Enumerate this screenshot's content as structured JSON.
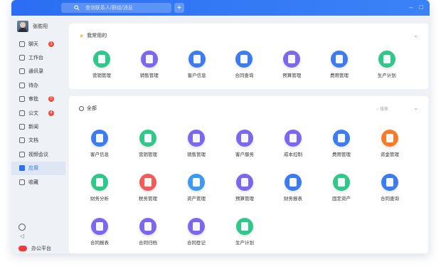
{
  "titlebar": {
    "search_placeholder": "查询联系人/群组/消息",
    "add": "+",
    "minimize": "–",
    "maximize": "□"
  },
  "user": {
    "name": "张胜阳"
  },
  "nav": [
    {
      "key": "chat",
      "label": "聊天",
      "badge": "1"
    },
    {
      "key": "workbench",
      "label": "工作台",
      "badge": ""
    },
    {
      "key": "contacts",
      "label": "通讯录",
      "badge": ""
    },
    {
      "key": "todo",
      "label": "待办",
      "badge": ""
    },
    {
      "key": "approval",
      "label": "审批",
      "badge": "5"
    },
    {
      "key": "document",
      "label": "公文",
      "badge": "4"
    },
    {
      "key": "news",
      "label": "新闻",
      "badge": ""
    },
    {
      "key": "archive",
      "label": "文档",
      "badge": ""
    },
    {
      "key": "video",
      "label": "视频会议",
      "badge": ""
    },
    {
      "key": "apps",
      "label": "应用",
      "badge": "",
      "active": true
    },
    {
      "key": "favorites",
      "label": "收藏",
      "badge": ""
    }
  ],
  "sidebar_footer": {
    "collapse": "◁",
    "office": "办公平台"
  },
  "frequent": {
    "title": "我常用的",
    "apps": [
      {
        "label": "营销管理",
        "icon": "marketing-icon",
        "color": "#2fc78c"
      },
      {
        "label": "销售管理",
        "icon": "sales-icon",
        "color": "#7b68ee"
      },
      {
        "label": "客户信息",
        "icon": "customer-info-icon",
        "color": "#3c7cf0"
      },
      {
        "label": "合同查询",
        "icon": "contract-query-icon",
        "color": "#3c7cf0"
      },
      {
        "label": "预算管理",
        "icon": "budget-icon",
        "color": "#7b68ee"
      },
      {
        "label": "费用管理",
        "icon": "expense-icon",
        "color": "#3c7cf0"
      },
      {
        "label": "生产计划",
        "icon": "production-plan-icon",
        "color": "#2fc78c"
      }
    ]
  },
  "all": {
    "title": "全部",
    "search_placeholder": "搜索",
    "apps": [
      {
        "label": "客户信息",
        "icon": "customer-info-icon",
        "color": "#3c7cf0"
      },
      {
        "label": "营销管理",
        "icon": "marketing-icon",
        "color": "#2fc78c"
      },
      {
        "label": "销售管理",
        "icon": "sales-icon",
        "color": "#7b68ee"
      },
      {
        "label": "客户服务",
        "icon": "customer-service-icon",
        "color": "#7b68ee"
      },
      {
        "label": "成本控制",
        "icon": "cost-control-icon",
        "color": "#7b68ee"
      },
      {
        "label": "费用管理",
        "icon": "expense-icon",
        "color": "#3c7cf0"
      },
      {
        "label": "资金管理",
        "icon": "fund-icon",
        "color": "#f57c2b"
      },
      {
        "label": "财务分析",
        "icon": "finance-analysis-icon",
        "color": "#2fc78c"
      },
      {
        "label": "税务管理",
        "icon": "tax-icon",
        "color": "#f25a5a"
      },
      {
        "label": "资产管理",
        "icon": "asset-icon",
        "color": "#3c9bf0"
      },
      {
        "label": "预算管理",
        "icon": "budget-icon",
        "color": "#7b68ee"
      },
      {
        "label": "财务报表",
        "icon": "finance-report-icon",
        "color": "#3c7cf0"
      },
      {
        "label": "固定资产",
        "icon": "fixed-asset-icon",
        "color": "#2fc78c"
      },
      {
        "label": "合同查询",
        "icon": "contract-query-icon",
        "color": "#3c7cf0"
      },
      {
        "label": "合同报表",
        "icon": "contract-report-icon",
        "color": "#7b68ee"
      },
      {
        "label": "合同归档",
        "icon": "contract-archive-icon",
        "color": "#7b68ee"
      },
      {
        "label": "合同登记",
        "icon": "contract-register-icon",
        "color": "#7b68ee"
      },
      {
        "label": "生产计划",
        "icon": "production-plan-icon",
        "color": "#2fc78c"
      }
    ]
  }
}
